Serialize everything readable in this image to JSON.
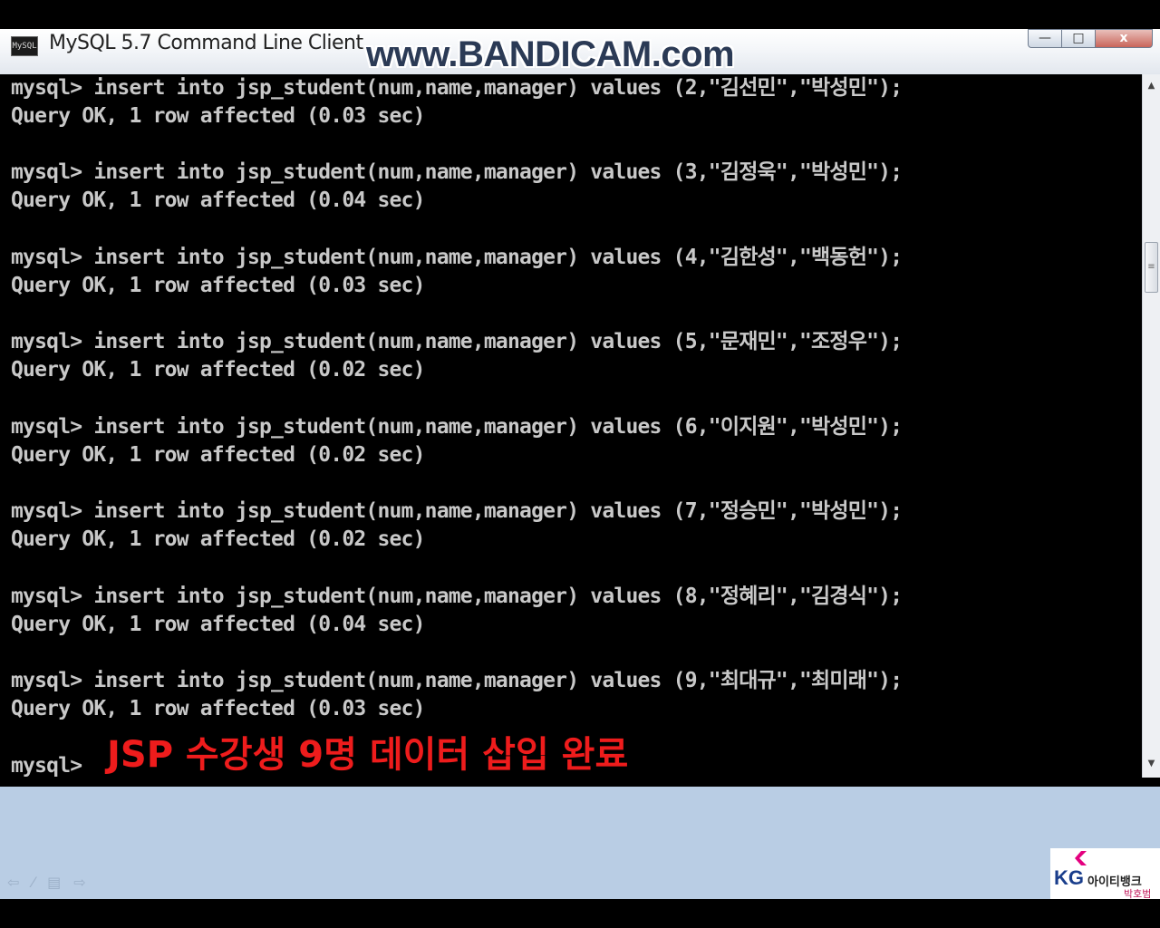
{
  "window": {
    "title": "MySQL 5.7 Command Line Client",
    "icon_label": "MySQL",
    "watermark": "www.BANDICAM.com",
    "buttons": {
      "minimize": "—",
      "maximize": "□",
      "close": "x"
    }
  },
  "console": {
    "lines": [
      "mysql> insert into jsp_student(num,name,manager) values (2,\"김선민\",\"박성민\");",
      "Query OK, 1 row affected (0.03 sec)",
      "",
      "mysql> insert into jsp_student(num,name,manager) values (3,\"김정욱\",\"박성민\");",
      "Query OK, 1 row affected (0.04 sec)",
      "",
      "mysql> insert into jsp_student(num,name,manager) values (4,\"김한성\",\"백동헌\");",
      "Query OK, 1 row affected (0.03 sec)",
      "",
      "mysql> insert into jsp_student(num,name,manager) values (5,\"문재민\",\"조정우\");",
      "Query OK, 1 row affected (0.02 sec)",
      "",
      "mysql> insert into jsp_student(num,name,manager) values (6,\"이지원\",\"박성민\");",
      "Query OK, 1 row affected (0.02 sec)",
      "",
      "mysql> insert into jsp_student(num,name,manager) values (7,\"정승민\",\"박성민\");",
      "Query OK, 1 row affected (0.02 sec)",
      "",
      "mysql> insert into jsp_student(num,name,manager) values (8,\"정혜리\",\"김경식\");",
      "Query OK, 1 row affected (0.04 sec)",
      "",
      "mysql> insert into jsp_student(num,name,manager) values (9,\"최대규\",\"최미래\");",
      "Query OK, 1 row affected (0.03 sec)",
      "",
      "mysql>"
    ]
  },
  "caption": "JSP 수강생 9명 데이터 삽입 완료",
  "slide_nav": [
    "⇦",
    "⁄",
    "▤",
    "⇨"
  ],
  "logo": {
    "kg": "KG",
    "brand": "아이티뱅크",
    "sub": "박호범"
  },
  "colors": {
    "console_bg": "#000000",
    "console_text": "#c8c8c8",
    "caption": "#ee1c1c",
    "slide_bg": "#b9cde4"
  }
}
